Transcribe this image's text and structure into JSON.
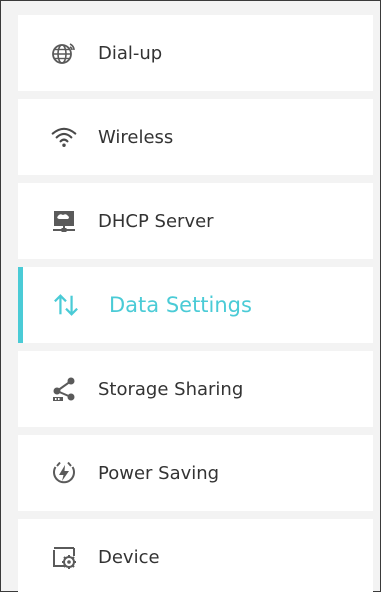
{
  "menu": {
    "items": [
      {
        "label": "Dial-up",
        "icon": "globe-antenna-icon",
        "active": false
      },
      {
        "label": "Wireless",
        "icon": "wifi-icon",
        "active": false
      },
      {
        "label": "DHCP Server",
        "icon": "dhcp-server-icon",
        "active": false
      },
      {
        "label": "Data Settings",
        "icon": "data-arrows-icon",
        "active": true
      },
      {
        "label": "Storage Sharing",
        "icon": "storage-share-icon",
        "active": false
      },
      {
        "label": "Power Saving",
        "icon": "power-bolt-icon",
        "active": false
      },
      {
        "label": "Device",
        "icon": "device-gear-icon",
        "active": false
      }
    ]
  },
  "colors": {
    "accent": "#4acbd6",
    "text": "#333333",
    "background": "#f3f3f3",
    "item_background": "#ffffff"
  }
}
